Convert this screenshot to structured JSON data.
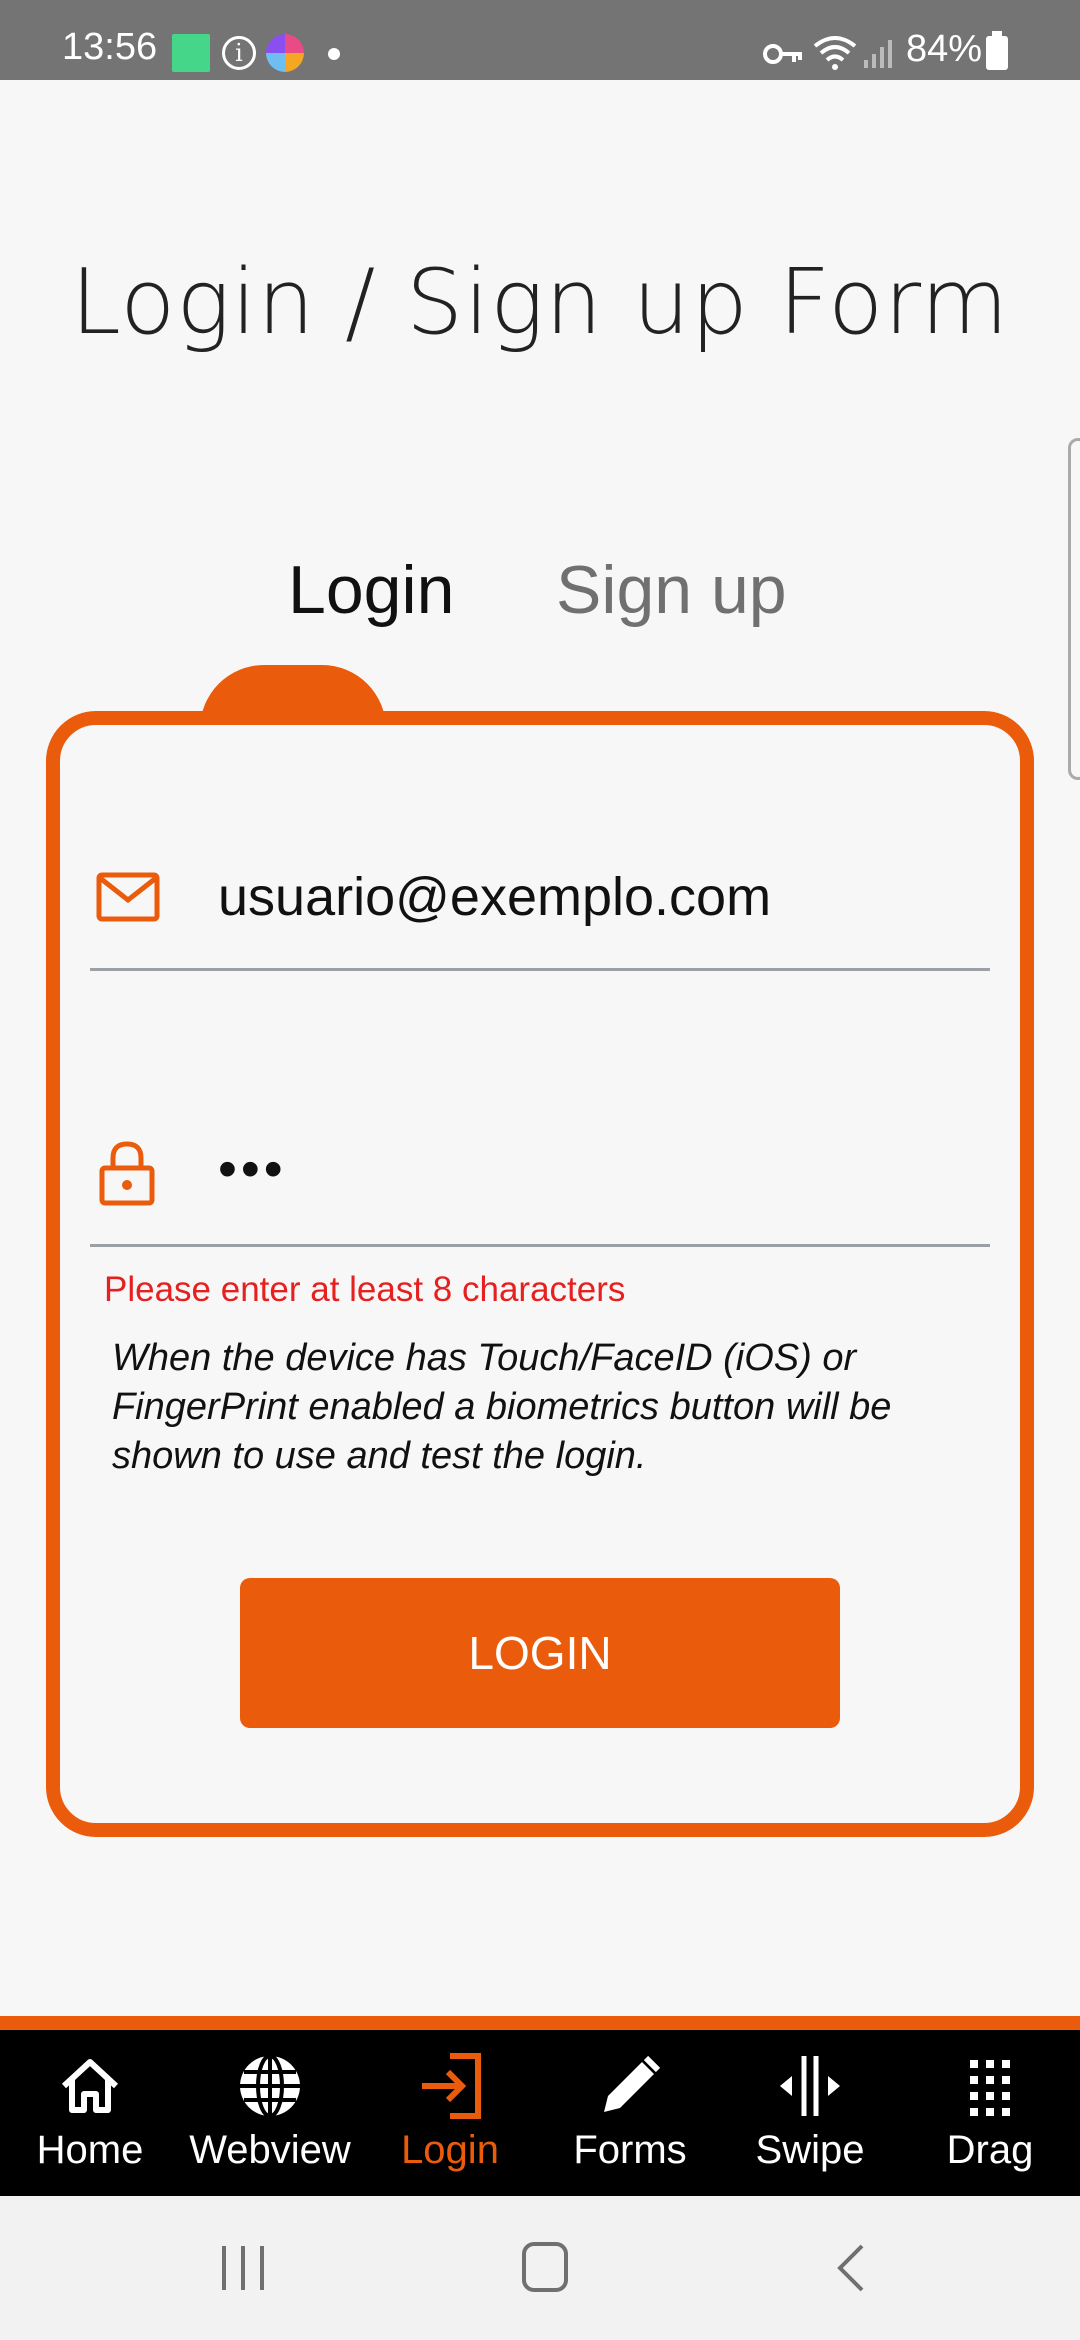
{
  "status_bar": {
    "time": "13:56",
    "battery": "84%",
    "icons": [
      "app-notification-icon",
      "info-icon",
      "browser-icon",
      "dot-icon",
      "vpn-key-icon",
      "wifi-icon",
      "signal-icon",
      "battery-icon"
    ]
  },
  "page": {
    "title": "Login / Sign up Form"
  },
  "tabs": {
    "login_label": "Login",
    "signup_label": "Sign up",
    "active": "Login"
  },
  "form": {
    "email_value": "usuario@exemplo.com",
    "password_value": "•••",
    "error": "Please enter at least 8 characters",
    "hint": "When the device has Touch/FaceID (iOS) or FingerPrint enabled a biometrics button will be shown to use and test the login.",
    "submit_label": "LOGIN"
  },
  "bottom_nav": {
    "items": [
      {
        "label": "Home",
        "icon": "home-icon"
      },
      {
        "label": "Webview",
        "icon": "globe-icon"
      },
      {
        "label": "Login",
        "icon": "login-icon",
        "active": true
      },
      {
        "label": "Forms",
        "icon": "pencil-icon"
      },
      {
        "label": "Swipe",
        "icon": "swipe-icon"
      },
      {
        "label": "Drag",
        "icon": "grid-icon"
      }
    ]
  },
  "colors": {
    "accent": "#ea5b0c",
    "error": "#e61f1f",
    "status_bar": "#747474",
    "nav_background": "#000000"
  }
}
